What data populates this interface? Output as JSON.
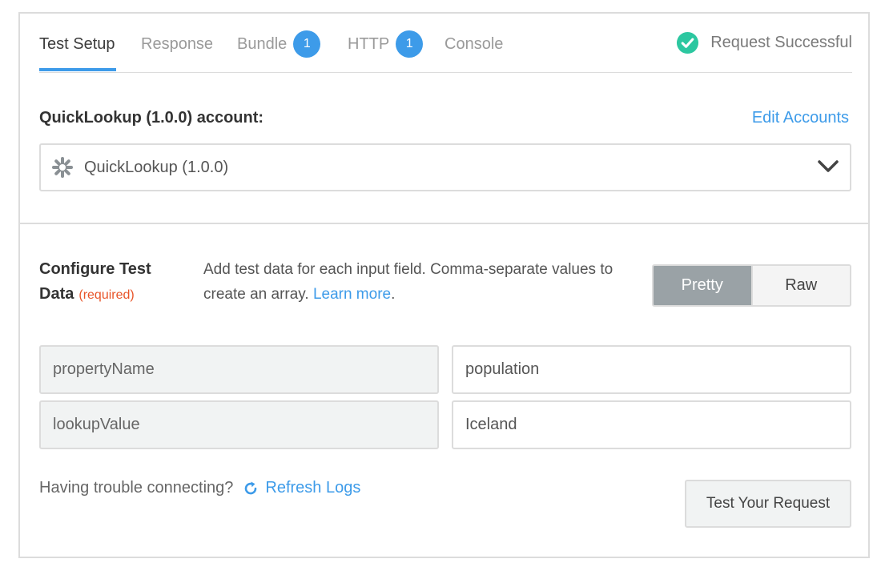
{
  "tabs": [
    {
      "label": "Test Setup",
      "active": true
    },
    {
      "label": "Response"
    },
    {
      "label": "Bundle",
      "badge": "1"
    },
    {
      "label": "HTTP",
      "badge": "1"
    },
    {
      "label": "Console"
    }
  ],
  "status": {
    "text": "Request Successful",
    "icon": "check-circle-icon",
    "color": "#2cc7a0"
  },
  "account": {
    "label": "QuickLookup (1.0.0) account:",
    "edit_link": "Edit Accounts",
    "selected": "QuickLookup (1.0.0)",
    "icon": "gear-icon"
  },
  "config": {
    "title": "Configure Test Data",
    "title_line1": "Configure Test",
    "title_line2": "Data",
    "required": "(required)",
    "description": "Add test data for each input field. Comma-separate values to create an array.",
    "learn_more": "Learn more",
    "learn_more_suffix": ".",
    "toggle": {
      "pretty": "Pretty",
      "raw": "Raw",
      "selected": "Pretty"
    }
  },
  "fields": [
    {
      "key": "propertyName",
      "value": "population"
    },
    {
      "key": "lookupValue",
      "value": "Iceland"
    }
  ],
  "footer": {
    "trouble_text": "Having trouble connecting?",
    "refresh_label": "Refresh Logs",
    "test_button": "Test Your Request"
  },
  "colors": {
    "accent": "#3d9be9",
    "required": "#e8552a",
    "success": "#2cc7a0"
  }
}
